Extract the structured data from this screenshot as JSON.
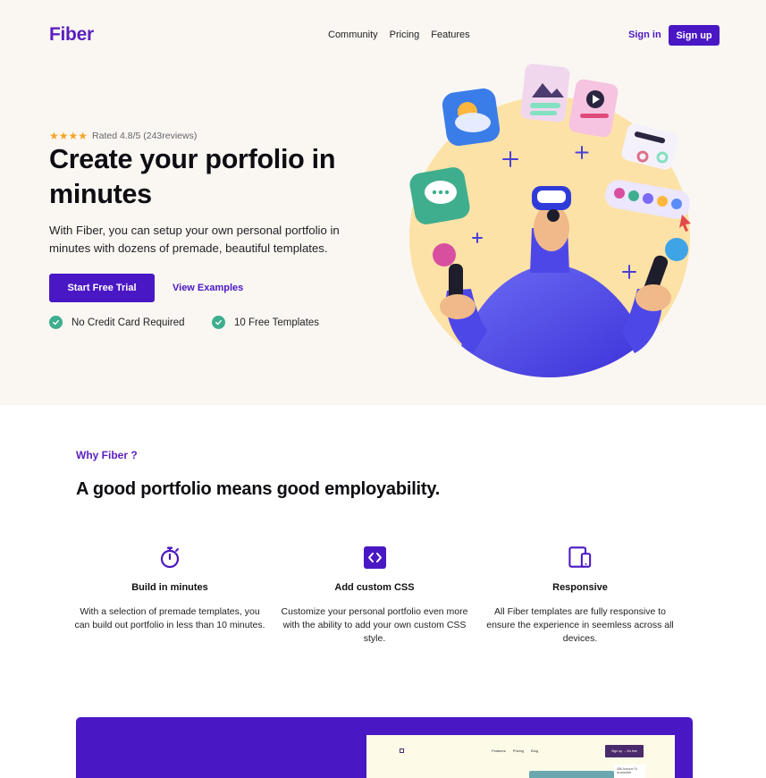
{
  "header": {
    "logo": "Fiber",
    "nav": [
      "Community",
      "Pricing",
      "Features"
    ],
    "signin_label": "Sign in",
    "signup_label": "Sign up"
  },
  "hero": {
    "rating_text": "Rated 4.8/5 (243reviews)",
    "stars": 4,
    "title": "Create your porfolio in minutes",
    "subtitle": "With Fiber, you can setup your own personal portfolio in minutes with dozens of premade, beautiful templates.",
    "cta_label": "Start Free Trial",
    "secondary_label": "View Examples",
    "checks": [
      "No Credit Card Required",
      "10 Free Templates"
    ]
  },
  "why": {
    "label": "Why Fiber ?",
    "title": "A good portfolio means good employability.",
    "features": [
      {
        "icon": "stopwatch-icon",
        "name": "Build in minutes",
        "desc": "With a selection of premade templates, you can build out portfolio in less than 10 minutes."
      },
      {
        "icon": "code-icon",
        "name": "Add custom CSS",
        "desc": "Customize your personal portfolio even more with the ability to add your own custom CSS style."
      },
      {
        "icon": "devices-icon",
        "name": "Responsive",
        "desc": "All Fiber templates are fully responsive to ensure the experience in seemless across all devices."
      }
    ]
  },
  "preview": {
    "nav": [
      "Features",
      "Pricing",
      "Blog"
    ],
    "button_label": "Sign up → It's free",
    "card_text": "456 Avenue St accessible"
  },
  "colors": {
    "brand": "#4a17c4",
    "hero_bg": "#faf7f3",
    "check": "#3fae8e",
    "star": "#f5a524"
  }
}
